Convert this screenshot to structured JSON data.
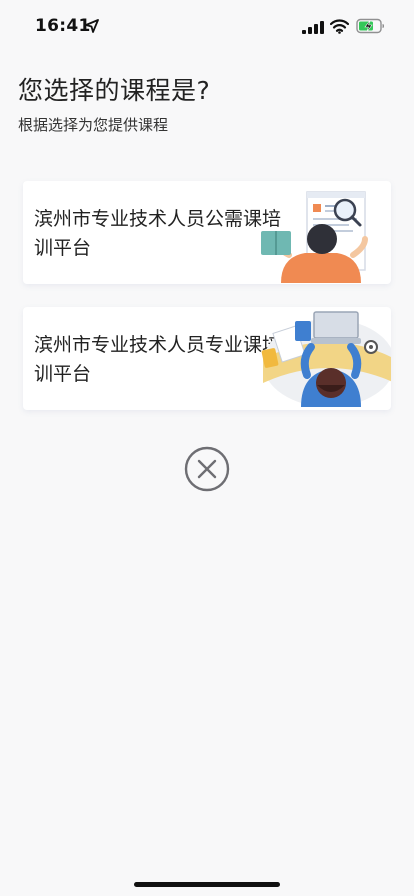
{
  "status_bar": {
    "time": "16:41",
    "icons": [
      "location-arrow-icon",
      "signal-icon",
      "wifi-icon",
      "battery-charging-icon"
    ]
  },
  "page": {
    "title": "您选择的课程是?",
    "subtitle": "根据选择为您提供课程"
  },
  "courses": [
    {
      "label": "滨州市专业技术人员公需课培训平台",
      "illustration": "reader-with-magnifier-illustration"
    },
    {
      "label": "滨州市专业技术人员专业课培训平台",
      "illustration": "person-at-laptop-illustration"
    }
  ],
  "close": {
    "icon": "close-circle-icon"
  },
  "colors": {
    "background": "#f8f8f9",
    "card": "#ffffff",
    "accent_orange": "#f08a52",
    "accent_blue": "#3f7fd0",
    "battery_green": "#34c759"
  }
}
